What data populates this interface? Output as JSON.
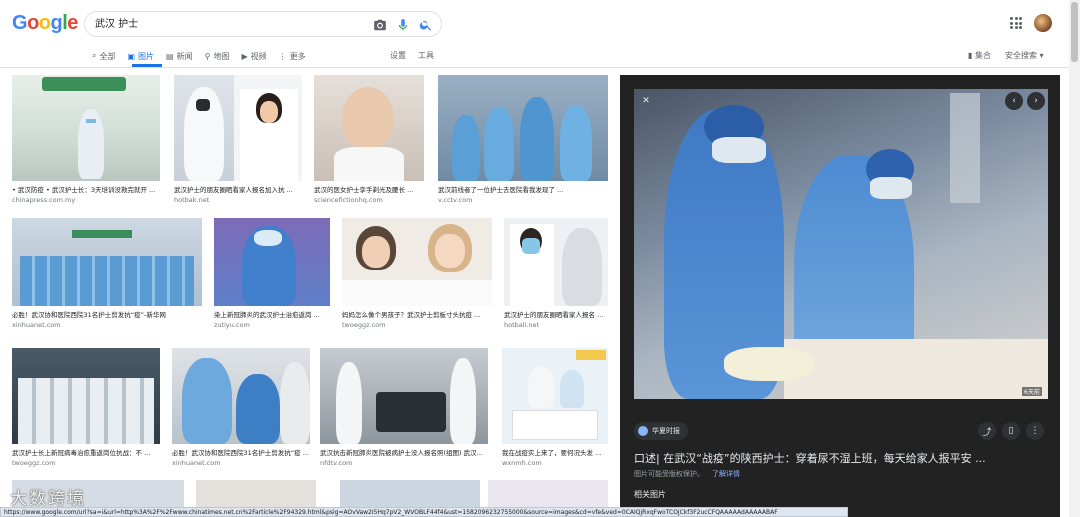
{
  "logo": "Google",
  "search": {
    "value": "武汉 护士"
  },
  "tabs": [
    {
      "label": "全部",
      "icon": "search-icon"
    },
    {
      "label": "图片",
      "icon": "image-icon",
      "active": true
    },
    {
      "label": "新闻",
      "icon": "news-icon"
    },
    {
      "label": "地图",
      "icon": "map-pin-icon"
    },
    {
      "label": "视频",
      "icon": "video-icon"
    },
    {
      "label": "更多",
      "icon": "more-vert-icon"
    }
  ],
  "settings_label": "设置",
  "tools_label": "工具",
  "collections_label": "集合",
  "safesearch_label": "安全搜索",
  "images": [
    {
      "caption": "• 武汉防疫 • 武汉护士长：3天培训没救完就开 ...",
      "source": "chinapress.com.my"
    },
    {
      "caption": "武汉护士的朋友圈晒看家人报名加入抗 ...",
      "source": "hotbak.net"
    },
    {
      "caption": "武汉的医女护士孪手剃光及腰长 ...",
      "source": "sciencefictionhq.com"
    },
    {
      "caption": "武汉前线者了一位护士去医院看我发现了 ...",
      "source": "v.cctv.com"
    },
    {
      "caption": "必胜！武汉协和医院西院31名护士剪发抗“疫”-新华网",
      "source": "xinhuanet.com"
    },
    {
      "caption": "染上新冠肺炎的武汉护士治愈返岗 ...",
      "source": "zutiyu.com"
    },
    {
      "caption": "妈妈怎么像个男孩子？武汉护士剪板寸头抗疫 ...",
      "source": "twoeggz.com"
    },
    {
      "caption": "武汉护士的朋友圈晒看家人报名 ...",
      "source": "hotbali.net"
    },
    {
      "caption": "武汉护士长上新冠病毒治愈重返岗位抗战：不 ...",
      "source": "twoeggz.com"
    },
    {
      "caption": "必胜！武汉协和医院西院31名护士剪发抗“疫 ...",
      "source": "xinhuanet.com"
    },
    {
      "caption": "武汉抗击新冠肺炎医院被病护士没人报名照(组图) 武汉防疫 ...",
      "source": "nfdtv.com"
    },
    {
      "caption": "我在战疫实上来了，要何况头发 ...",
      "source": "wxnmh.com"
    }
  ],
  "panel": {
    "site": "华夏时报",
    "title": "口述| 在武汉“战疫”的陕西护士：穿着尿不湿上班，每天给家人报平安 ...",
    "note": "图片可能受版权保护。",
    "details_link": "了解详情",
    "related": "相关图片",
    "time_badge": "6天前"
  },
  "status_url": "https://www.google.com/url?sa=i&url=http%3A%2F%2Fwww.chinatimes.net.cn%2Farticle%2F94329.html&psig=AOvVaw2I5Hq7pV2_WVOBLF44f4&ust=1582096232755000&source=images&cd=vfe&ved=0CAIQjRxqFwoTCOjCkf3F2ucCFQAAAAAdAAAAABAF",
  "watermark": "大数跨境"
}
